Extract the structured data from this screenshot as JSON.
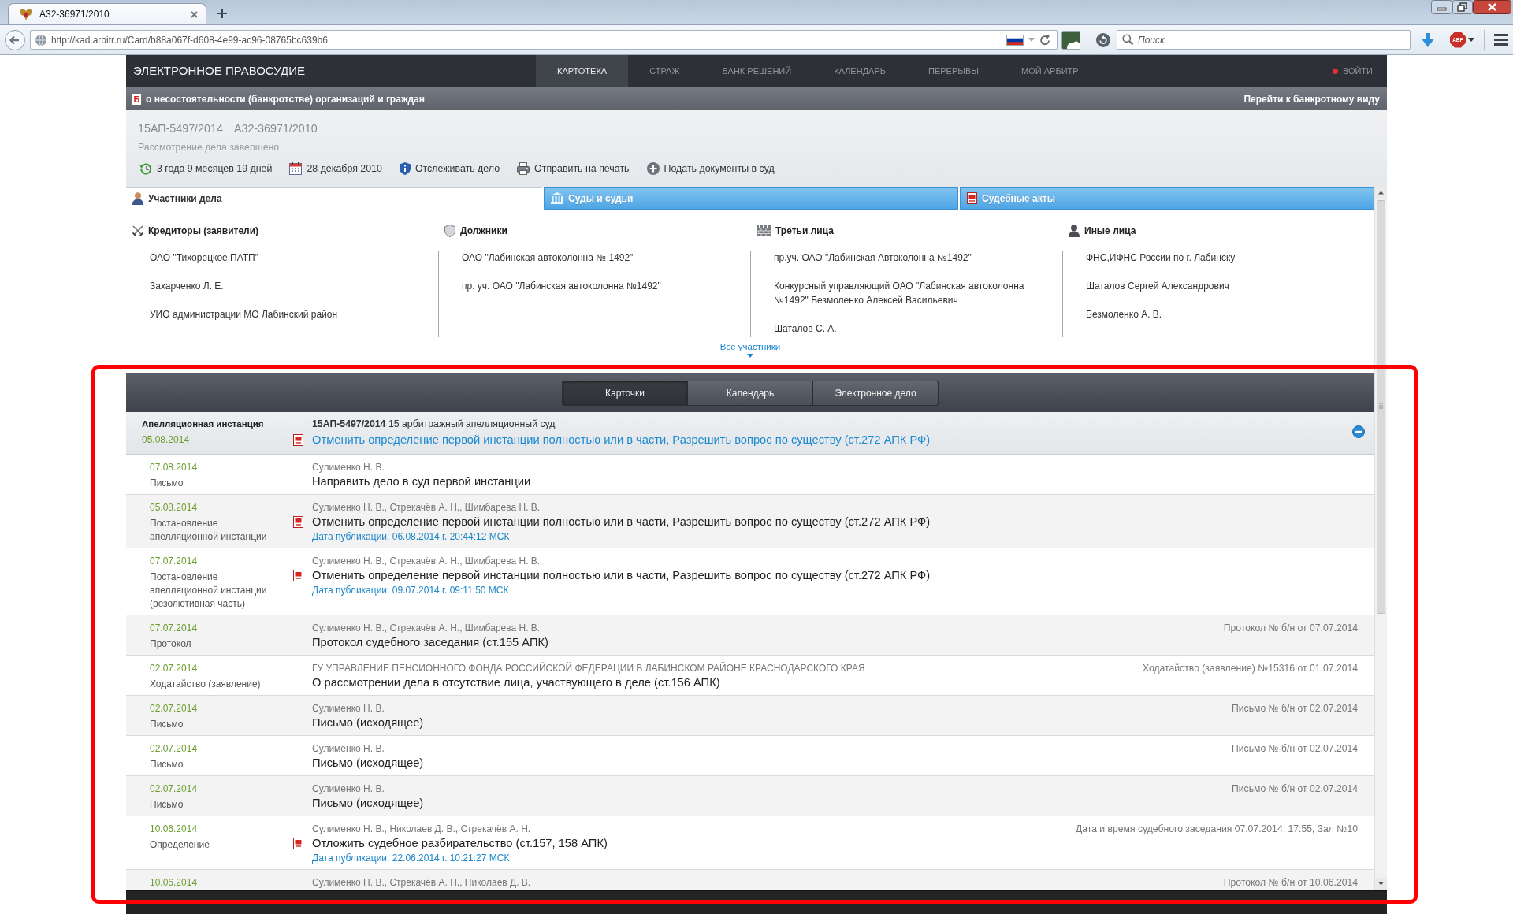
{
  "browser": {
    "tab_title": "А32-36971/2010",
    "url": "http://kad.arbitr.ru/Card/b88a067f-d608-4e99-ac96-08765bc639b6",
    "search": {
      "placeholder": "Поиск"
    },
    "addon_badge": "ABP"
  },
  "header": {
    "title": "ЭЛЕКТРОННОЕ ПРАВОСУДИЕ",
    "nav": [
      {
        "label": "КАРТОТЕКА",
        "selected": true
      },
      {
        "label": "СТРАЖ",
        "selected": false
      },
      {
        "label": "БАНК РЕШЕНИЙ",
        "selected": false
      },
      {
        "label": "КАЛЕНДАРЬ",
        "selected": false
      },
      {
        "label": "ПЕРЕРЫВЫ",
        "selected": false
      },
      {
        "label": "МОЙ АРБИТР",
        "selected": false
      }
    ],
    "login": "ВОЙТИ"
  },
  "category_bar": {
    "mark": "Б",
    "title": "о несостоятельности (банкротстве) организаций и граждан",
    "link": "Перейти к банкротному виду"
  },
  "case": {
    "numbers": [
      "15АП-5497/2014",
      "А32-36971/2010"
    ],
    "status": "Рассмотрение дела завершено",
    "actions": [
      {
        "kind": "duration",
        "label": "3 года 9 месяцев 19 дней"
      },
      {
        "kind": "date",
        "label": "28 декабря 2010"
      },
      {
        "kind": "track",
        "label": "Отслеживать дело"
      },
      {
        "kind": "print",
        "label": "Отправить на печать"
      },
      {
        "kind": "submit",
        "label": "Подать документы в суд"
      }
    ]
  },
  "tabs": [
    {
      "kind": "participants",
      "label": "Участники дела",
      "selected": true
    },
    {
      "kind": "courts",
      "label": "Суды и судьи",
      "selected": false
    },
    {
      "kind": "acts",
      "label": "Судебные акты",
      "selected": false
    }
  ],
  "participants": {
    "groups": [
      {
        "kind": "creditors",
        "title": "Кредиторы (заявители)",
        "items": [
          "ОАО \"Тихорецкое ПАТП\"",
          "Захарченко Л. Е.",
          "УИО администрации МО Лабинский район"
        ]
      },
      {
        "kind": "debtors",
        "title": "Должники",
        "items": [
          "ОАО \"Лабинская автоколонна № 1492\"",
          "пр. уч. ОАО \"Лабинская автоколонна №1492\""
        ]
      },
      {
        "kind": "third_parties",
        "title": "Третьи лица",
        "items": [
          "пр.уч. ОАО \"Лабинская Автоколонна №1492\"",
          "Конкурсный управляющий ОАО \"Лабинская автоколонна №1492\" Безмоленко Алексей Васильевич",
          "Шаталов С. А."
        ]
      },
      {
        "kind": "others",
        "title": "Иные лица",
        "items": [
          "ФНС,ИФНС России по г. Лабинску",
          "Шаталов Сергей Александрович",
          "Безмоленко А. В."
        ]
      }
    ],
    "all_link": "Все участники"
  },
  "timeline": {
    "views": [
      {
        "label": "Карточки",
        "selected": true
      },
      {
        "label": "Календарь",
        "selected": false
      },
      {
        "label": "Электронное дело",
        "selected": false
      }
    ],
    "instance": {
      "title": "Апелляционная инстанция",
      "date": "05.08.2014",
      "case_line": "**15АП-5497/2014** 15 арбитражный апелляционный суд",
      "decision": "Отменить определение первой инстанции полностью или в части, Разрешить вопрос по существу (ст.272 АПК РФ)",
      "pdf": true,
      "expanded": true
    },
    "entries": [
      {
        "date": "07.08.2014",
        "doc_type": "Письмо",
        "authors": "Сулименко Н. В.",
        "title": "Направить дело в суд первой инстанции",
        "pdf": false
      },
      {
        "date": "05.08.2014",
        "doc_type": "Постановление апелляционной инстанции",
        "authors": "Сулименко Н. В., Стрекачёв А. Н., Шимбарева Н. В.",
        "title": "Отменить определение первой инстанции полностью или в части, Разрешить вопрос по существу (ст.272 АПК РФ)",
        "pdf": true,
        "published": "Дата публикации: 06.08.2014 г. 20:44:12 МСК"
      },
      {
        "date": "07.07.2014",
        "doc_type": "Постановление апелляционной инстанции (резолютивная часть)",
        "authors": "Сулименко Н. В., Стрекачёв А. Н., Шимбарева Н. В.",
        "title": "Отменить определение первой инстанции полностью или в части, Разрешить вопрос по существу (ст.272 АПК РФ)",
        "pdf": true,
        "published": "Дата публикации: 09.07.2014 г. 09:11:50 МСК"
      },
      {
        "date": "07.07.2014",
        "doc_type": "Протокол",
        "authors": "Сулименко Н. В., Стрекачёв А. Н., Шимбарева Н. В.",
        "title": "Протокол судебного заседания (ст.155 АПК)",
        "pdf": false,
        "note": "Протокол № б/н от 07.07.2014"
      },
      {
        "date": "02.07.2014",
        "doc_type": "Ходатайство (заявление)",
        "authors": "ГУ УПРАВЛЕНИЕ ПЕНСИОННОГО ФОНДА РОССИЙСКОЙ ФЕДЕРАЦИИ В ЛАБИНСКОМ РАЙОНЕ КРАСНОДАРСКОГО КРАЯ",
        "title": "О рассмотрении дела в отсутствие лица, участвующего в деле (ст.156 АПК)",
        "pdf": false,
        "note": "Ходатайство (заявление) №15316 от 01.07.2014"
      },
      {
        "date": "02.07.2014",
        "doc_type": "Письмо",
        "authors": "Сулименко Н. В.",
        "title": "Письмо (исходящее)",
        "pdf": false,
        "note": "Письмо № б/н от 02.07.2014"
      },
      {
        "date": "02.07.2014",
        "doc_type": "Письмо",
        "authors": "Сулименко Н. В.",
        "title": "Письмо (исходящее)",
        "pdf": false,
        "note": "Письмо № б/н от 02.07.2014"
      },
      {
        "date": "02.07.2014",
        "doc_type": "Письмо",
        "authors": "Сулименко Н. В.",
        "title": "Письмо (исходящее)",
        "pdf": false,
        "note": "Письмо № б/н от 02.07.2014"
      },
      {
        "date": "10.06.2014",
        "doc_type": "Определение",
        "authors": "Сулименко Н. В., Николаев Д. В., Стрекачёв А. Н.",
        "title": "Отложить судебное разбирательство (ст.157, 158 АПК)",
        "pdf": true,
        "published": "Дата публикации: 22.06.2014 г. 10:21:27 МСК",
        "note": "Дата и время судебного заседания 07.07.2014, 17:55, Зал №10"
      },
      {
        "date": "10.06.2014",
        "authors": "Сулименко Н. В., Стрекачёв А. Н., Николаев Д. В.",
        "pdf": false,
        "note": "Протокол № б/н от 10.06.2014"
      }
    ]
  },
  "highlight": {
    "kind": "frame"
  }
}
